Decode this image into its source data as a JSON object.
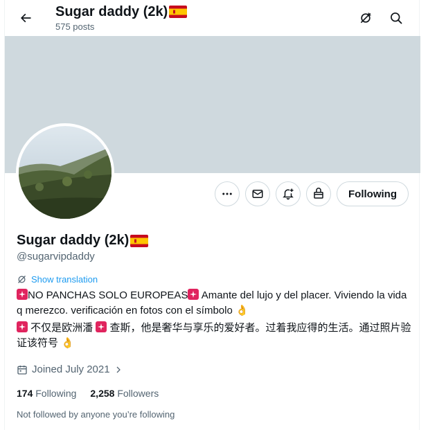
{
  "header": {
    "back_icon": "arrow-left-icon",
    "title": "Sugar daddy (2k)",
    "title_flag": "spain-flag",
    "posts_count": "575 posts",
    "icons": [
      "no-translate-icon",
      "search-icon"
    ]
  },
  "profile": {
    "name": "Sugar daddy (2k)",
    "handle": "@sugarvipdaddy",
    "show_translation": "Show translation",
    "bio_line1_a": "NO PANCHAS SOLO EUROPEAS",
    "bio_line1_b": " Amante del lujo y del placer. Viviendo la vida q merezco. verificación en fotos con el símbolo ",
    "bio_line2_a": " 不仅是欧洲潘 ",
    "bio_line2_b": " 查斯，他是奢华与享乐的爱好者。过着我应得的生活。通过照片验证该符号 ",
    "ok_emoji": "👌",
    "joined": "Joined July 2021",
    "following_count": "174",
    "following_label": "Following",
    "followers_count": "2,258",
    "followers_label": "Followers",
    "not_followed": "Not followed by anyone you’re following"
  },
  "actions": {
    "more_icon": "more-icon",
    "message_icon": "mail-icon",
    "notify_icon": "bell-plus-icon",
    "subscribe_icon": "gift-icon",
    "following_button": "Following"
  },
  "colors": {
    "banner": "#cfd9de",
    "accent": "#1d9bf0",
    "muted": "#536471",
    "text": "#0f1419"
  }
}
